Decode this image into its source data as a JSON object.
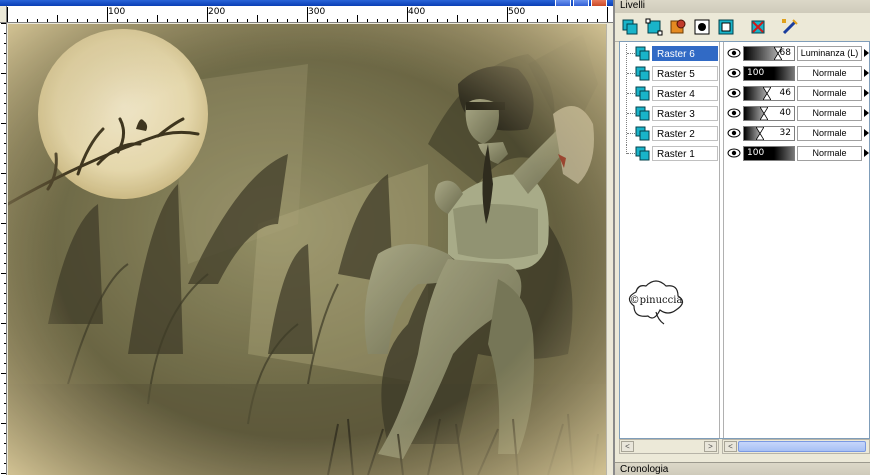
{
  "ruler": {
    "labels": [
      "100",
      "200",
      "300",
      "400",
      "500"
    ]
  },
  "panel": {
    "title": "Livelli"
  },
  "toolbar": {
    "icons": [
      "new-raster-layer-icon",
      "new-vector-layer-icon",
      "new-art-media-layer-icon",
      "new-mask-layer-icon",
      "new-adjustment-layer-icon",
      "delete-layer-icon",
      "edit-selection-icon"
    ]
  },
  "layers": [
    {
      "name": "Raster 6",
      "opacity": "68",
      "blend": "Luminanza (L)",
      "selected": true
    },
    {
      "name": "Raster 5",
      "opacity": "100",
      "blend": "Normale",
      "selected": false
    },
    {
      "name": "Raster 4",
      "opacity": "46",
      "blend": "Normale",
      "selected": false
    },
    {
      "name": "Raster 3",
      "opacity": "40",
      "blend": "Normale",
      "selected": false
    },
    {
      "name": "Raster 2",
      "opacity": "32",
      "blend": "Normale",
      "selected": false
    },
    {
      "name": "Raster 1",
      "opacity": "100",
      "blend": "Normale",
      "selected": false
    }
  ],
  "watermark": {
    "text": "©pinuccia"
  },
  "scroll": {
    "left_arrow": "<",
    "right_arrow": ">"
  },
  "chronology": {
    "title": "Cronologia"
  }
}
